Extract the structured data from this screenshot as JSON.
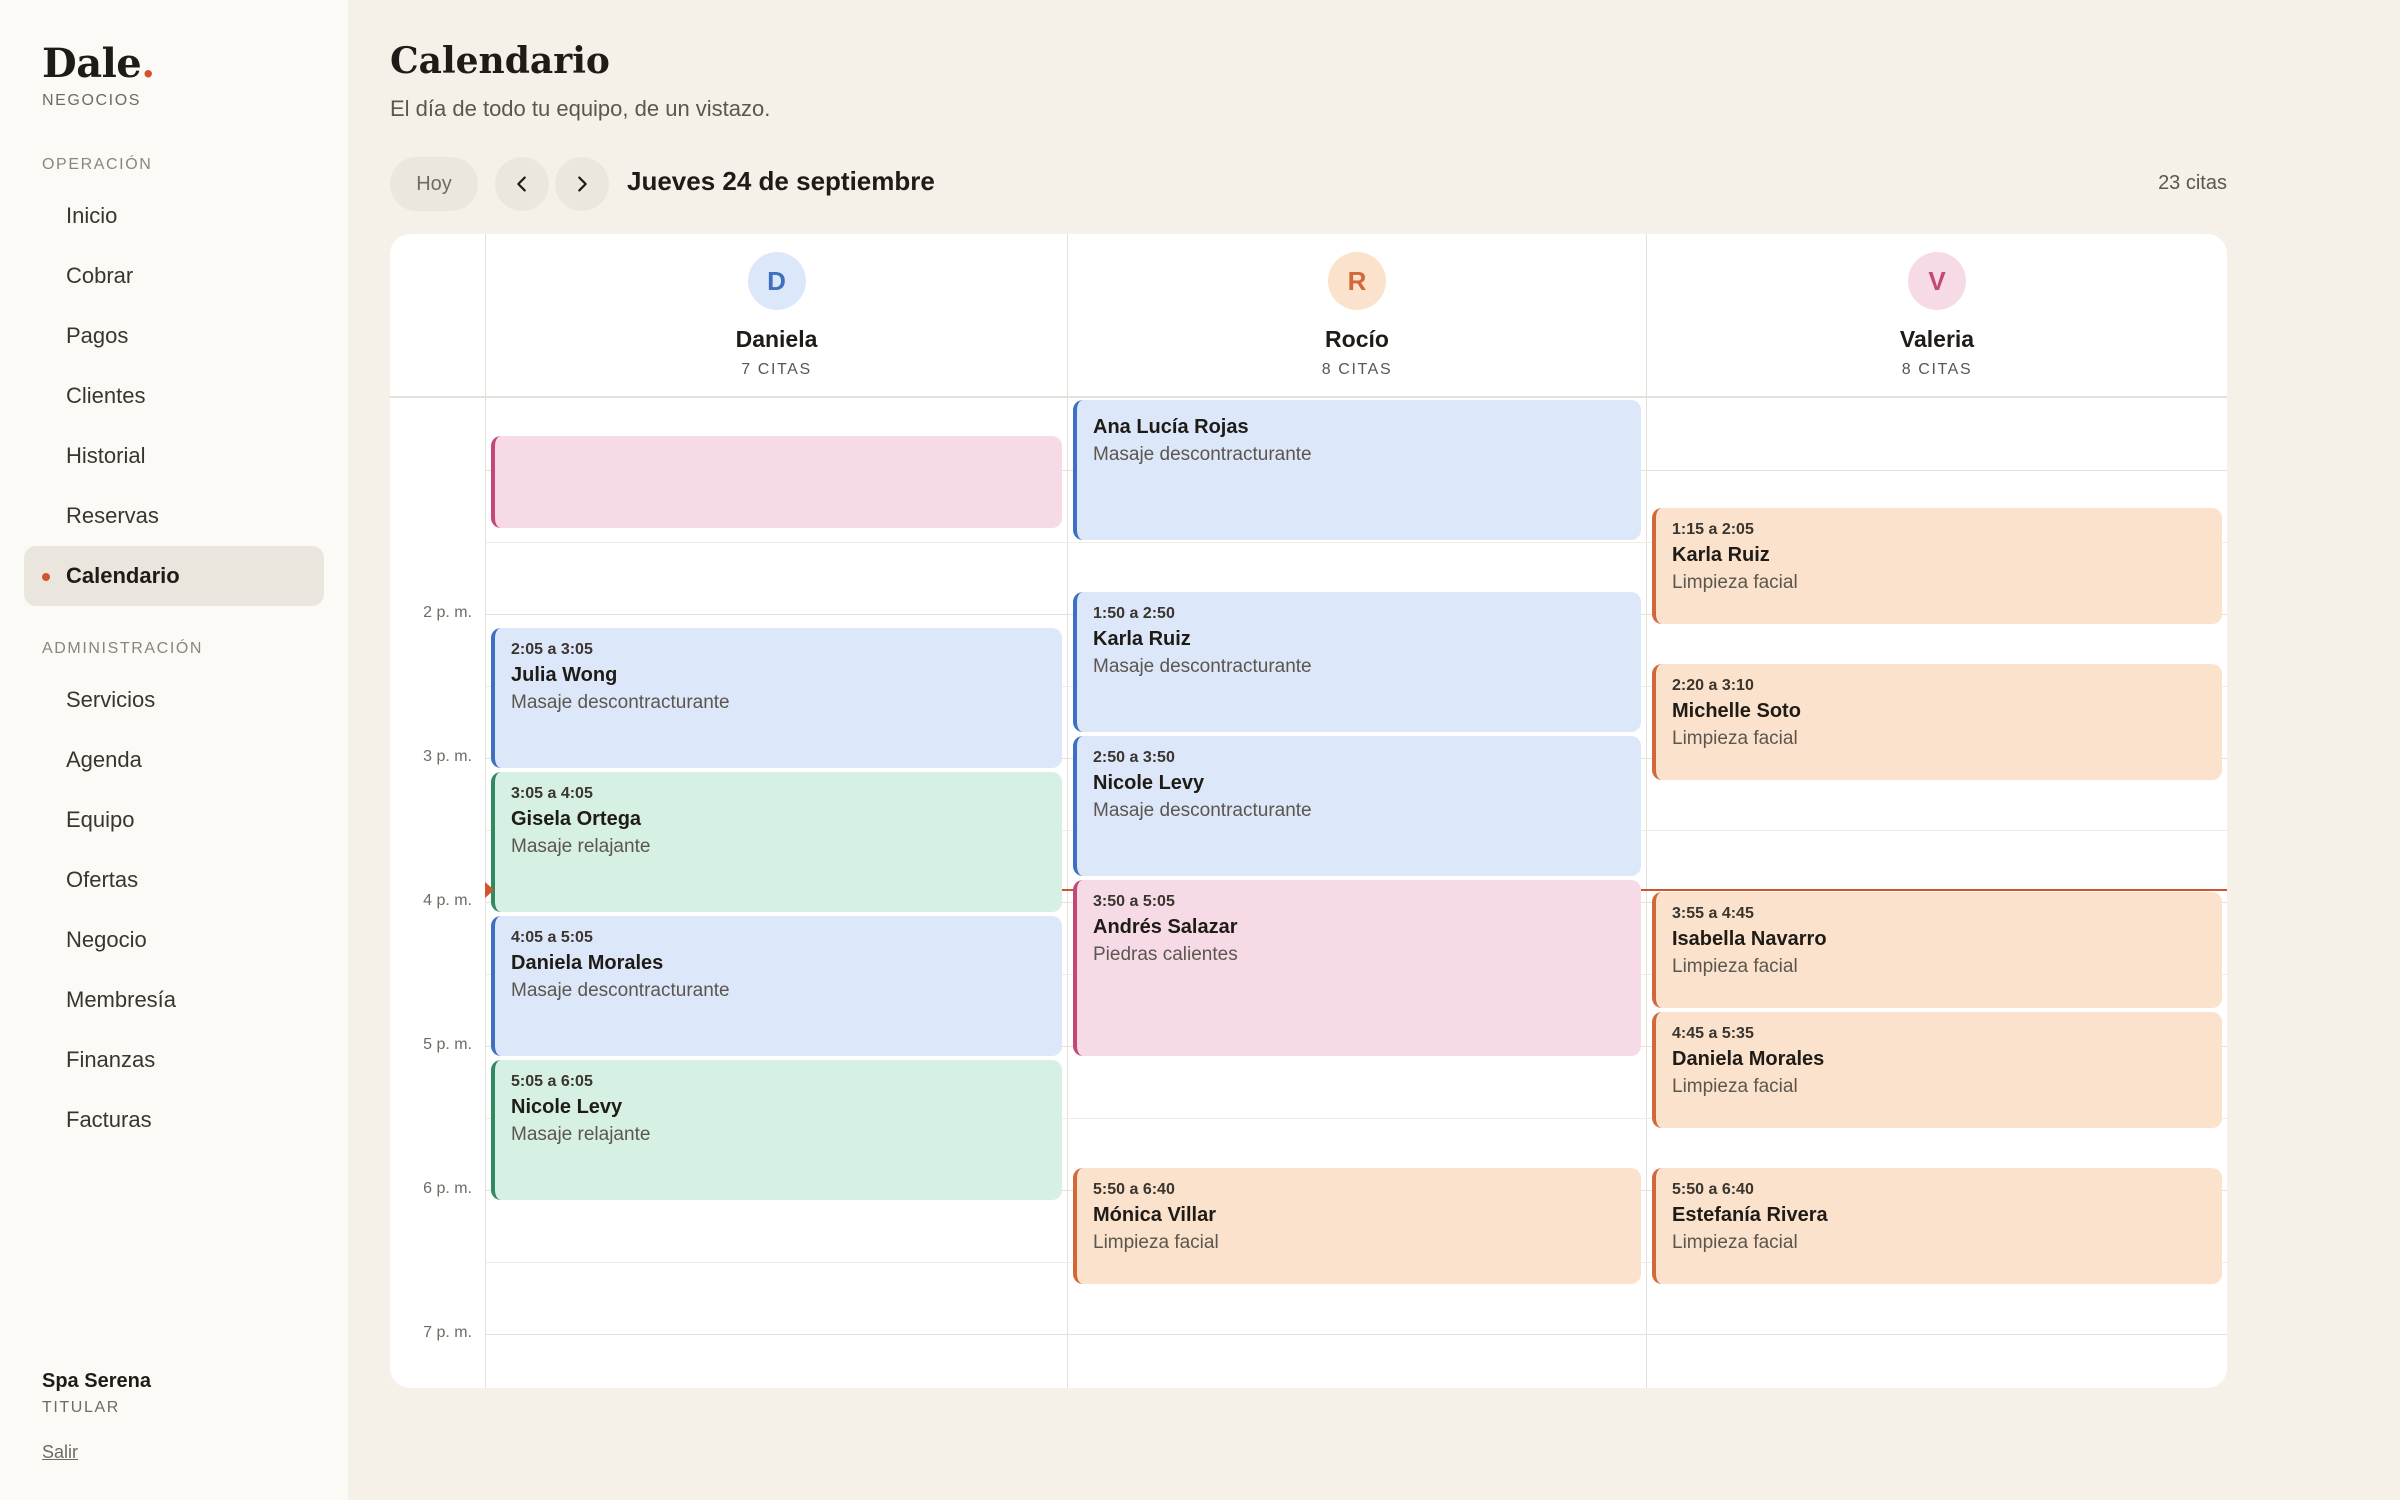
{
  "sidebar": {
    "brand": "Dale",
    "brand_dot": ".",
    "brand_sub": "NEGOCIOS",
    "sections": [
      {
        "label": "OPERACIÓN",
        "items": [
          "Inicio",
          "Cobrar",
          "Pagos",
          "Clientes",
          "Historial",
          "Reservas",
          "Calendario"
        ]
      },
      {
        "label": "ADMINISTRACIÓN",
        "items": [
          "Servicios",
          "Agenda",
          "Equipo",
          "Ofertas",
          "Negocio",
          "Membresía",
          "Finanzas",
          "Facturas"
        ]
      }
    ],
    "active_item": "Calendario",
    "business_name": "Spa Serena",
    "business_role": "TITULAR",
    "logout": "Salir"
  },
  "header": {
    "title": "Calendario",
    "subtitle": "El día de todo tu equipo, de un vistazo.",
    "today_button": "Hoy",
    "prev_icon": "chevron-left-icon",
    "next_icon": "chevron-right-icon",
    "date": "Jueves 24 de septiembre",
    "total": "23 citas"
  },
  "calendar": {
    "time_labels": [
      "2 p. m.",
      "3 p. m.",
      "4 p. m.",
      "5 p. m.",
      "6 p. m.",
      "7 p. m."
    ],
    "now_time": "3:55",
    "columns": [
      {
        "initial": "D",
        "name": "Daniela",
        "count": "7 CITAS",
        "avatar_bg": "#dde7fa",
        "avatar_color": "#3e6fc2",
        "appointments": [
          {
            "time": "",
            "client": "",
            "service": "",
            "color": "pink",
            "start_min": 765,
            "end_min": 805
          },
          {
            "time": "2:05 a 3:05",
            "client": "Julia Wong",
            "service": "Masaje descontracturante",
            "color": "blue",
            "start_min": 845,
            "end_min": 905
          },
          {
            "time": "3:05 a 4:05",
            "client": "Gisela Ortega",
            "service": "Masaje relajante",
            "color": "green",
            "start_min": 905,
            "end_min": 965
          },
          {
            "time": "4:05 a 5:05",
            "client": "Daniela Morales",
            "service": "Masaje descontracturante",
            "color": "blue",
            "start_min": 965,
            "end_min": 1025
          },
          {
            "time": "5:05 a 6:05",
            "client": "Nicole Levy",
            "service": "Masaje relajante",
            "color": "green",
            "start_min": 1025,
            "end_min": 1085
          }
        ]
      },
      {
        "initial": "R",
        "name": "Rocío",
        "count": "8 CITAS",
        "avatar_bg": "#fbe2cc",
        "avatar_color": "#d2683a",
        "appointments": [
          {
            "time": "",
            "client": "Ana Lucía Rojas",
            "service": "Masaje descontracturante",
            "color": "blue",
            "start_min": 750,
            "end_min": 810
          },
          {
            "time": "1:50 a 2:50",
            "client": "Karla Ruiz",
            "service": "Masaje descontracturante",
            "color": "blue",
            "start_min": 830,
            "end_min": 890
          },
          {
            "time": "2:50 a 3:50",
            "client": "Nicole Levy",
            "service": "Masaje descontracturante",
            "color": "blue",
            "start_min": 890,
            "end_min": 950
          },
          {
            "time": "3:50 a 5:05",
            "client": "Andrés Salazar",
            "service": "Piedras calientes",
            "color": "pink",
            "start_min": 950,
            "end_min": 1025
          },
          {
            "time": "5:50 a 6:40",
            "client": "Mónica Villar",
            "service": "Limpieza facial",
            "color": "peach",
            "start_min": 1070,
            "end_min": 1120
          }
        ]
      },
      {
        "initial": "V",
        "name": "Valeria",
        "count": "8 CITAS",
        "avatar_bg": "#f6dbe7",
        "avatar_color": "#c4477a",
        "appointments": [
          {
            "time": "1:15 a 2:05",
            "client": "Karla Ruiz",
            "service": "Limpieza facial",
            "color": "peach",
            "start_min": 795,
            "end_min": 845
          },
          {
            "time": "2:20 a 3:10",
            "client": "Michelle Soto",
            "service": "Limpieza facial",
            "color": "peach",
            "start_min": 860,
            "end_min": 910
          },
          {
            "time": "3:55 a 4:45",
            "client": "Isabella Navarro",
            "service": "Limpieza facial",
            "color": "peach",
            "start_min": 955,
            "end_min": 1005
          },
          {
            "time": "4:45 a 5:35",
            "client": "Daniela Morales",
            "service": "Limpieza facial",
            "color": "peach",
            "start_min": 1005,
            "end_min": 1055
          },
          {
            "time": "5:50 a 6:40",
            "client": "Estefanía Rivera",
            "service": "Limpieza facial",
            "color": "peach",
            "start_min": 1070,
            "end_min": 1120
          }
        ]
      }
    ]
  },
  "colors": {
    "accent": "#d1552b",
    "background": "#f5f1e8",
    "sidebar": "#fcfaf6"
  }
}
